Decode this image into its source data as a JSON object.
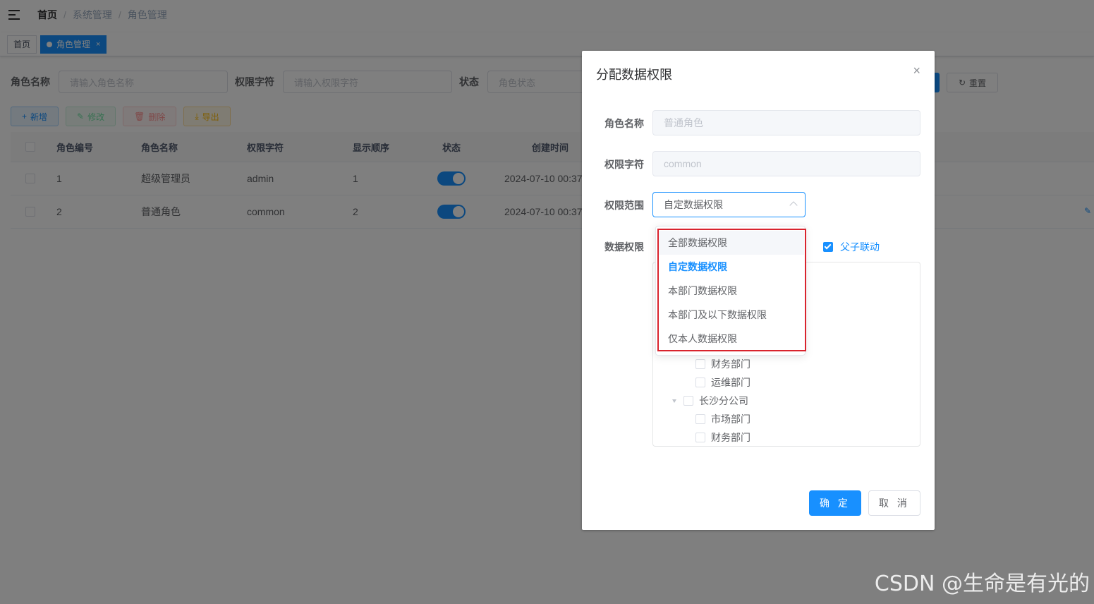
{
  "navbar": {
    "breadcrumb": [
      "首页",
      "系统管理",
      "角色管理"
    ]
  },
  "tags": [
    {
      "label": "首页",
      "active": false
    },
    {
      "label": "角色管理",
      "active": true,
      "close": "×"
    }
  ],
  "search": {
    "role_name_label": "角色名称",
    "role_name_placeholder": "请输入角色名称",
    "role_key_label": "权限字符",
    "role_key_placeholder": "请输入权限字符",
    "status_label": "状态",
    "status_placeholder": "角色状态",
    "reset_label": "重置"
  },
  "toolbar": {
    "add_label": "新增",
    "edit_label": "修改",
    "delete_label": "删除",
    "export_label": "导出"
  },
  "table": {
    "columns": [
      "角色编号",
      "角色名称",
      "权限字符",
      "显示顺序",
      "状态",
      "创建时间"
    ],
    "rows": [
      {
        "id": "1",
        "name": "超级管理员",
        "key": "admin",
        "order": "1",
        "status": true,
        "created": "2024-07-10 00:37"
      },
      {
        "id": "2",
        "name": "普通角色",
        "key": "common",
        "order": "2",
        "status": true,
        "created": "2024-07-10 00:37"
      }
    ]
  },
  "dialog": {
    "title": "分配数据权限",
    "close": "×",
    "role_name_label": "角色名称",
    "role_name_value": "普通角色",
    "role_key_label": "权限字符",
    "role_key_value": "common",
    "scope_label": "权限范围",
    "scope_value": "自定数据权限",
    "data_scope_label": "数据权限",
    "linkage_label": "父子联动",
    "linkage_checked": true,
    "tree": [
      {
        "label": "财务部门",
        "level": 2
      },
      {
        "label": "运维部门",
        "level": 2
      },
      {
        "label": "长沙分公司",
        "level": 1,
        "expanded": true
      },
      {
        "label": "市场部门",
        "level": 2
      },
      {
        "label": "财务部门",
        "level": 2
      }
    ],
    "ok_label": "确 定",
    "cancel_label": "取 消"
  },
  "dropdown": {
    "options": [
      "全部数据权限",
      "自定数据权限",
      "本部门数据权限",
      "本部门及以下数据权限",
      "仅本人数据权限"
    ],
    "selected_index": 1,
    "hover_index": 0
  },
  "watermark": "CSDN @生命是有光的",
  "colors": {
    "primary": "#1890ff",
    "highlight_border": "#d9232d"
  }
}
